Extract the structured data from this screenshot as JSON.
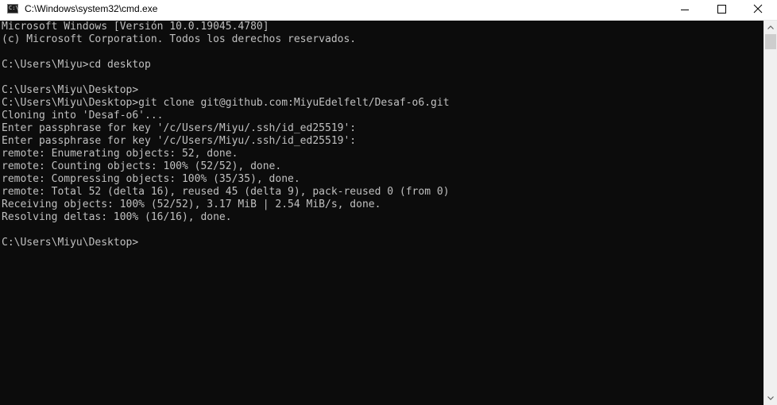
{
  "window": {
    "title": "C:\\Windows\\system32\\cmd.exe",
    "icon": "cmd-icon",
    "buttons": {
      "minimize_icon": "minimize-icon",
      "maximize_icon": "maximize-icon",
      "close_icon": "close-icon"
    }
  },
  "console": {
    "background": "#0c0c0c",
    "foreground": "#c0c0c0",
    "lines": [
      "Microsoft Windows [Versión 10.0.19045.4780]",
      "(c) Microsoft Corporation. Todos los derechos reservados.",
      "",
      "C:\\Users\\Miyu>cd desktop",
      "",
      "C:\\Users\\Miyu\\Desktop>",
      "C:\\Users\\Miyu\\Desktop>git clone git@github.com:MiyuEdelfelt/Desaf-o6.git",
      "Cloning into 'Desaf-o6'...",
      "Enter passphrase for key '/c/Users/Miyu/.ssh/id_ed25519':",
      "Enter passphrase for key '/c/Users/Miyu/.ssh/id_ed25519':",
      "remote: Enumerating objects: 52, done.",
      "remote: Counting objects: 100% (52/52), done.",
      "remote: Compressing objects: 100% (35/35), done.",
      "remote: Total 52 (delta 16), reused 45 (delta 9), pack-reused 0 (from 0)",
      "Receiving objects: 100% (52/52), 3.17 MiB | 2.54 MiB/s, done.",
      "Resolving deltas: 100% (16/16), done.",
      "",
      "C:\\Users\\Miyu\\Desktop>"
    ]
  },
  "scrollbar": {
    "up_icon": "scroll-up-arrow-icon",
    "down_icon": "scroll-down-arrow-icon"
  }
}
